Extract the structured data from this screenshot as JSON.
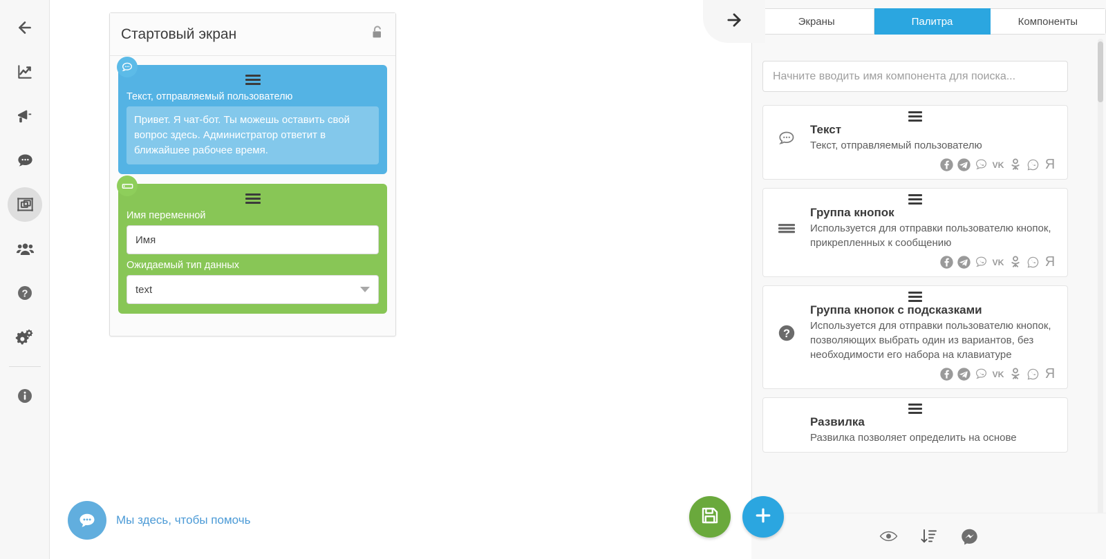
{
  "left_rail": {
    "items": [
      {
        "name": "back",
        "icon": "arrow-left-icon"
      },
      {
        "name": "analytics",
        "icon": "chart-line-icon"
      },
      {
        "name": "broadcast",
        "icon": "megaphone-icon"
      },
      {
        "name": "dialogs",
        "icon": "chat-bubble-icon"
      },
      {
        "name": "constructor",
        "icon": "screens-frame-icon",
        "active": true
      },
      {
        "name": "users",
        "icon": "users-group-icon"
      },
      {
        "name": "help",
        "icon": "question-circle-icon"
      },
      {
        "name": "settings",
        "icon": "gears-icon"
      },
      {
        "name": "info",
        "icon": "info-circle-icon"
      }
    ]
  },
  "canvas": {
    "screen_card": {
      "title": "Стартовый экран",
      "lock_icon": "unlock-icon",
      "blocks": [
        {
          "type": "text",
          "color": "#54b3e4",
          "badge_icon": "chat-bubble-icon",
          "label": "Текст, отправляемый пользователю",
          "value": "Привет. Я чат-бот. Ты можешь оставить свой вопрос здесь. Администратор ответит в ближайшее рабочее время."
        },
        {
          "type": "input",
          "color": "#88c656",
          "badge_icon": "text-field-icon",
          "field_label": "Имя переменной",
          "field_value": "Имя",
          "select_label": "Ожидаемый тип данных",
          "select_value": "text"
        }
      ]
    }
  },
  "chat_widget": {
    "icon": "chat-dots-icon",
    "text": "Мы здесь, чтобы помочь"
  },
  "fabs": [
    {
      "name": "save",
      "icon": "floppy-disk-icon",
      "color": "#6aa93c"
    },
    {
      "name": "add",
      "icon": "plus-icon",
      "color": "#2ba6e0"
    }
  ],
  "right_panel": {
    "toggle_icon": "arrow-right-icon",
    "tabs": [
      {
        "label": "Экраны",
        "active": false
      },
      {
        "label": "Палитра",
        "active": true
      },
      {
        "label": "Компоненты",
        "active": false
      }
    ],
    "search": {
      "placeholder": "Начните вводить имя компонента для поиска...",
      "value": ""
    },
    "palette": [
      {
        "title": "Текст",
        "desc": "Текст, отправляемый пользователю",
        "icon": "chat-bubble-icon",
        "socials": [
          "facebook",
          "telegram",
          "viber",
          "vk",
          "odnoklassniki",
          "whatsapp",
          "yandex"
        ]
      },
      {
        "title": "Группа кнопок",
        "desc": "Используется для отправки пользователю кнопок, прикрепленных к сообщению",
        "icon": "list-lines-icon",
        "socials": [
          "facebook",
          "telegram",
          "viber",
          "vk",
          "odnoklassniki",
          "whatsapp",
          "yandex"
        ]
      },
      {
        "title": "Группа кнопок с подсказками",
        "desc": "Используется для отправки пользователю кнопок, позволяющих выбрать один из вариантов, без необходимости его набора на клавиатуре",
        "icon": "question-circle-icon",
        "socials": [
          "facebook",
          "telegram",
          "viber",
          "vk",
          "odnoklassniki",
          "whatsapp",
          "yandex"
        ]
      },
      {
        "title": "Развилка",
        "desc": "Развилка позволяет определить на основе",
        "icon": "",
        "socials": []
      }
    ],
    "footer_icons": [
      {
        "name": "preview-eye",
        "icon": "eye-icon"
      },
      {
        "name": "sort",
        "icon": "sort-descending-icon"
      },
      {
        "name": "messenger",
        "icon": "messenger-icon"
      }
    ]
  },
  "colors": {
    "accent": "#2ba6e0",
    "text_block": "#54b3e4",
    "input_block": "#88c656",
    "save_green": "#6aa93c"
  }
}
